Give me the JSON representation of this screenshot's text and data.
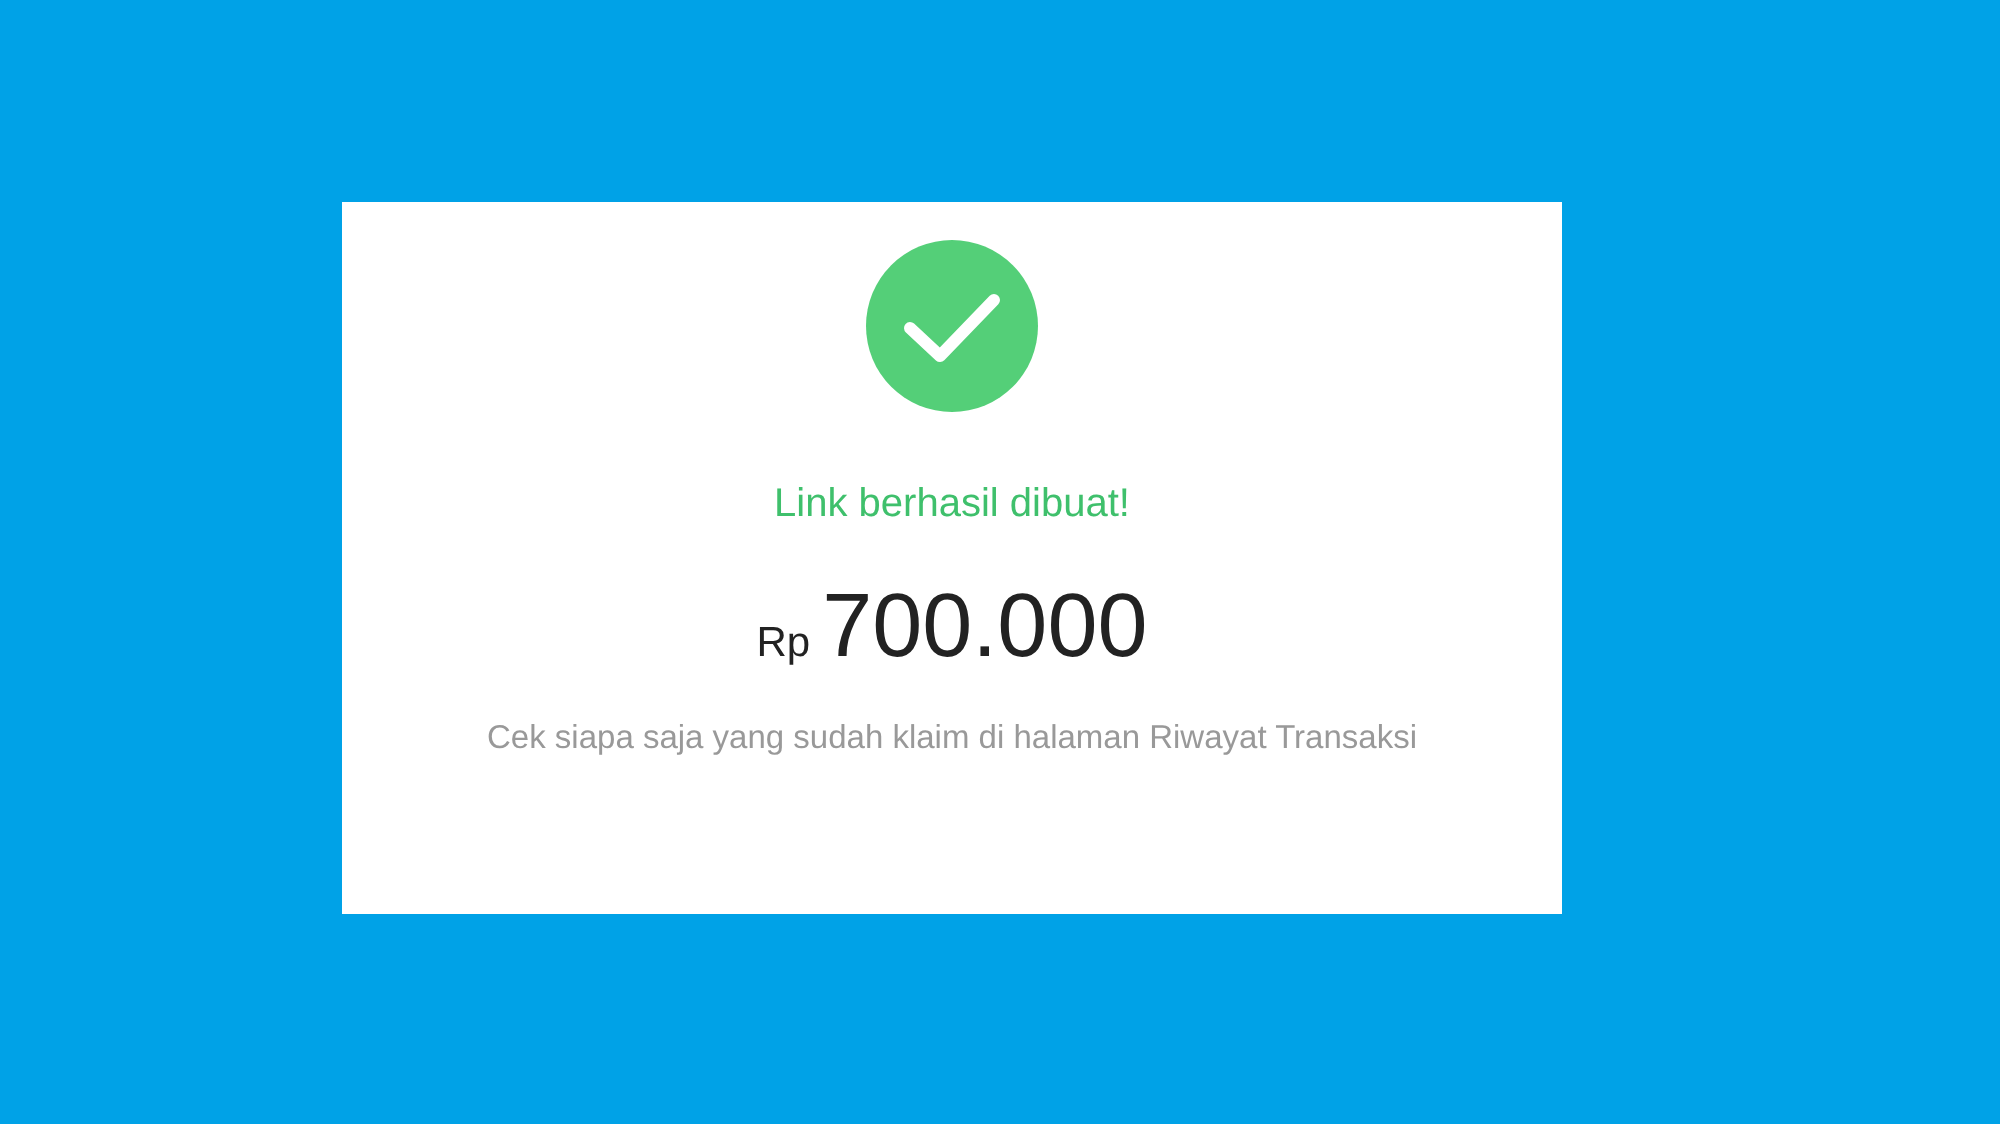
{
  "title": "Link berhasil dibuat!",
  "amount": {
    "currency": "Rp",
    "value": "700.000"
  },
  "note": "Cek siapa saja yang sudah klaim di halaman Riwayat Transaksi"
}
